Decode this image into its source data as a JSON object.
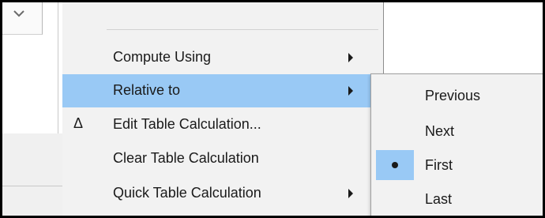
{
  "menu": {
    "items": [
      {
        "label": "Compute Using",
        "glyph": "",
        "has_submenu": true
      },
      {
        "label": "Relative to",
        "glyph": "",
        "has_submenu": true,
        "highlighted": true
      },
      {
        "label": "Edit Table Calculation...",
        "glyph": "Δ",
        "has_submenu": false
      },
      {
        "label": "Clear Table Calculation",
        "glyph": "",
        "has_submenu": false
      },
      {
        "label": "Quick Table Calculation",
        "glyph": "",
        "has_submenu": true
      }
    ]
  },
  "submenu": {
    "items": [
      {
        "label": "Previous",
        "selected": false
      },
      {
        "label": "Next",
        "selected": false
      },
      {
        "label": "First",
        "selected": true
      },
      {
        "label": "Last",
        "selected": false
      }
    ]
  },
  "icons": {
    "dropdown": "chevron-down-icon",
    "submenu_arrow": "submenu-arrow-icon",
    "delta": "delta-icon",
    "radio": "bullet-icon"
  },
  "colors": {
    "highlight": "#99c9f5",
    "menu_background": "#f2f2f2",
    "app_band": "#f0f0f0"
  }
}
